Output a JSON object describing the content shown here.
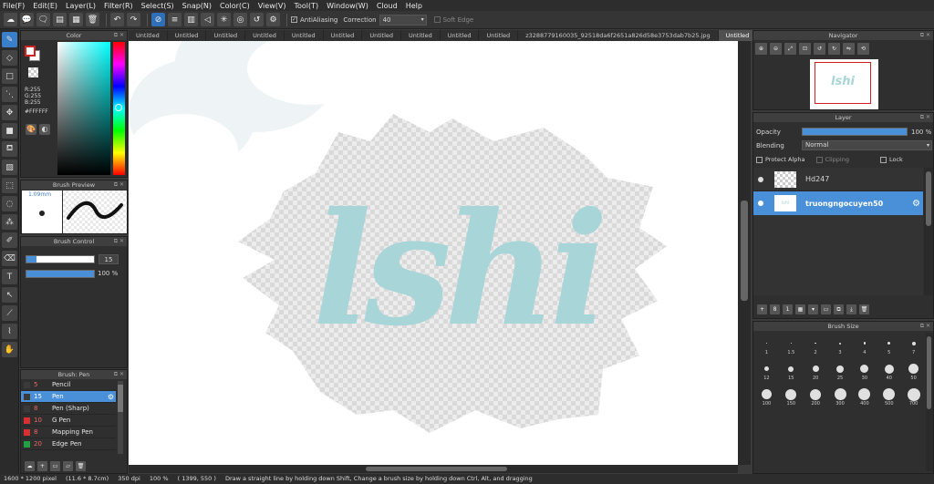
{
  "menu": [
    "File(F)",
    "Edit(E)",
    "Layer(L)",
    "Filter(R)",
    "Select(S)",
    "Snap(N)",
    "Color(C)",
    "View(V)",
    "Tool(T)",
    "Window(W)",
    "Cloud",
    "Help"
  ],
  "toolbar": {
    "antialiasing_label": "AntiAliasing",
    "correction_label": "Correction",
    "correction_value": "40",
    "soft_edge_label": "Soft Edge"
  },
  "color_panel": {
    "title": "Color",
    "r": "R:255",
    "g": "G:255",
    "b": "B:255",
    "hex": "#FFFFFF"
  },
  "brush_preview": {
    "title": "Brush Preview",
    "size": "1.09mm"
  },
  "brush_control": {
    "title": "Brush Control",
    "size_value": "15",
    "opacity_value": "100 %",
    "size_fraction": 0.15,
    "opacity_fraction": 1.0
  },
  "brush_list": {
    "title": "Brush: Pen",
    "items": [
      {
        "size": "5",
        "name": "Pencil",
        "color": "#3a3a3a"
      },
      {
        "size": "15",
        "name": "Pen",
        "color": "#3a3a3a",
        "selected": true
      },
      {
        "size": "8",
        "name": "Pen (Sharp)",
        "color": "#3a3a3a"
      },
      {
        "size": "10",
        "name": "G Pen",
        "color": "#d83030"
      },
      {
        "size": "8",
        "name": "Mapping Pen",
        "color": "#d83030"
      },
      {
        "size": "20",
        "name": "Edge Pen",
        "color": "#20a040"
      }
    ]
  },
  "tabs": [
    "Untitled",
    "Untitled",
    "Untitled",
    "Untitled",
    "Untitled",
    "Untitled",
    "Untitled",
    "Untitled",
    "Untitled",
    "Untitled",
    "z3288779160035_92518da6f2651a826d58e3753dab7b25.jpg",
    "Untitled"
  ],
  "canvas": {
    "text": "lshi",
    "text_color": "#a8d5d8"
  },
  "navigator": {
    "title": "Navigator",
    "thumb_text": "lshi"
  },
  "layer_panel": {
    "title": "Layer",
    "opacity_label": "Opacity",
    "opacity_value": "100 %",
    "opacity_fraction": 1.0,
    "blending_label": "Blending",
    "blending_value": "Normal",
    "protect_alpha_label": "Protect Alpha",
    "clipping_label": "Clipping",
    "lock_label": "Lock",
    "layers": [
      {
        "name": "Hd247",
        "selected": false
      },
      {
        "name": "truongngocuyen50",
        "selected": true
      }
    ]
  },
  "brush_size": {
    "title": "Brush Size",
    "row1": [
      "1",
      "1.5",
      "2",
      "3",
      "4",
      "5",
      "7"
    ],
    "row2": [
      "12",
      "15",
      "20",
      "25",
      "30",
      "40",
      "50"
    ],
    "row3": [
      "100",
      "150",
      "200",
      "300",
      "400",
      "500",
      "700"
    ]
  },
  "status": {
    "dimensions": "1600 * 1200 pixel",
    "physical": "(11.6 * 8.7cm)",
    "dpi": "350 dpi",
    "zoom": "100 %",
    "coords": "( 1399, 550 )",
    "hint": "Draw a straight line by holding down Shift, Change a brush size by holding down Ctrl, Alt, and dragging"
  },
  "colors": {
    "accent": "#4a90d9",
    "panel_bg": "#2f2f2f",
    "selection": "#3a7fc9"
  }
}
